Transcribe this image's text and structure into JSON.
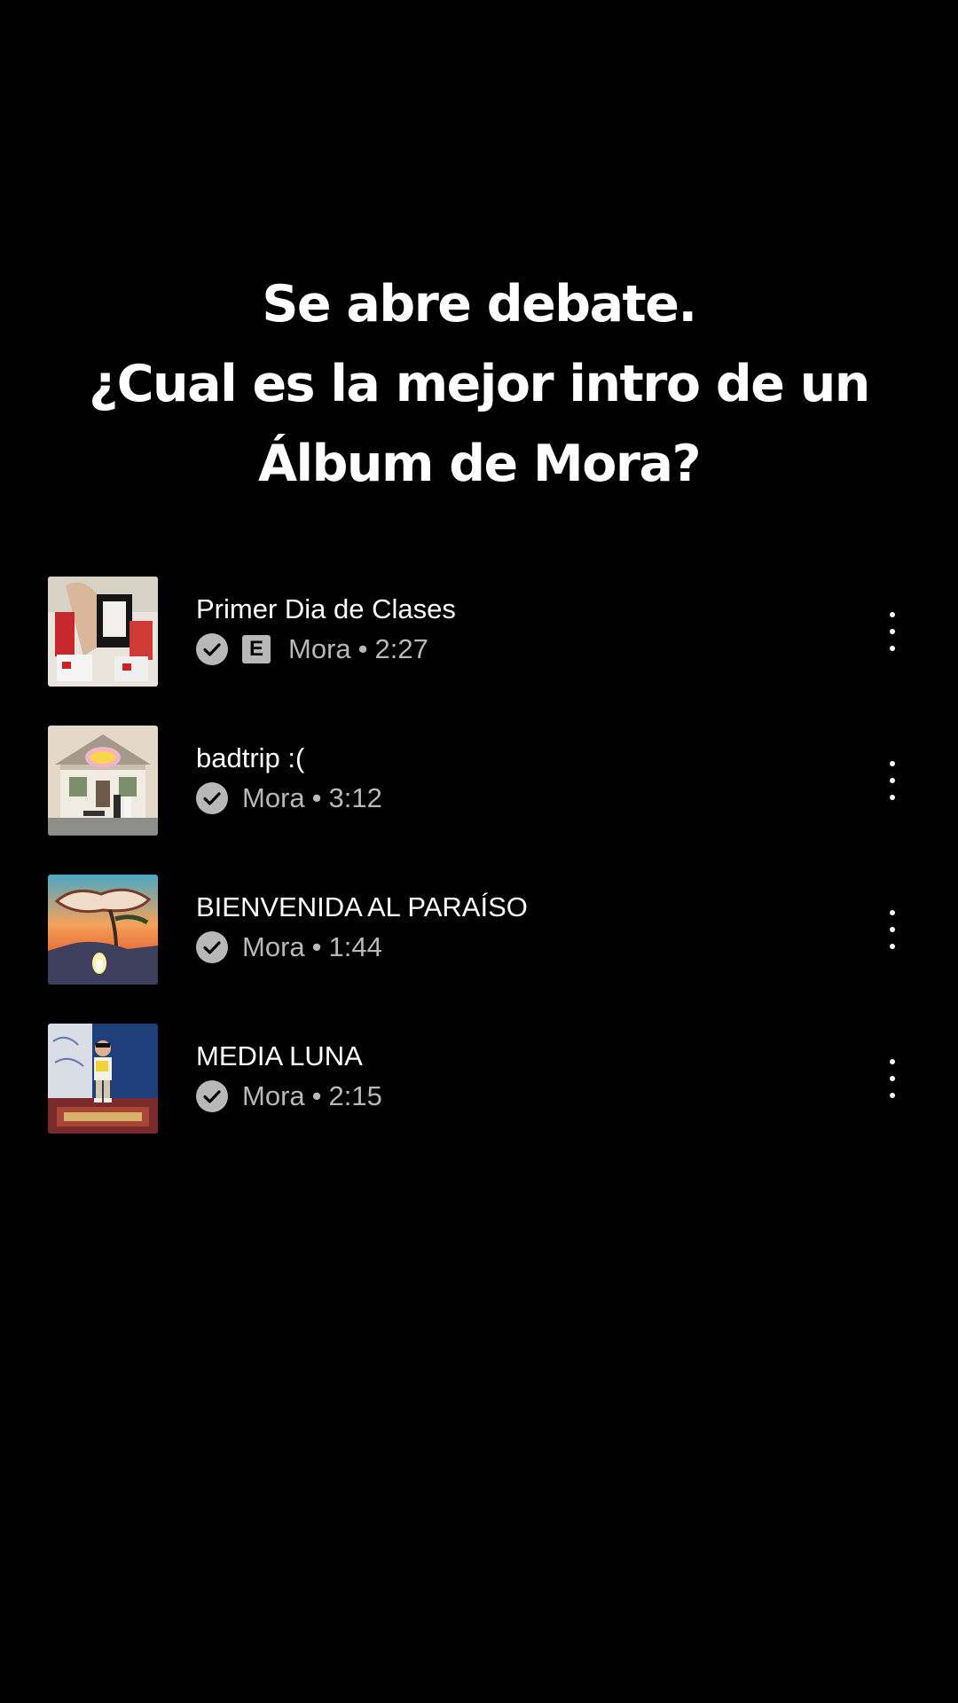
{
  "headline": {
    "line1": "Se abre debate.",
    "line2": "¿Cual es la mejor intro de un",
    "line3": "Álbum de Mora?"
  },
  "tracks": [
    {
      "title": "Primer Dia de Clases",
      "artist": "Mora",
      "duration": "2:27",
      "explicit": true,
      "explicit_label": "E",
      "artwork_icon": "album-art-primer-dia-de-clases"
    },
    {
      "title": "badtrip :(",
      "artist": "Mora",
      "duration": "3:12",
      "explicit": false,
      "artwork_icon": "album-art-house"
    },
    {
      "title": "BIENVENIDA AL PARAÍSO",
      "artist": "Mora",
      "duration": "1:44",
      "explicit": false,
      "artwork_icon": "album-art-paraiso"
    },
    {
      "title": "MEDIA LUNA",
      "artist": "Mora",
      "duration": "2:15",
      "explicit": false,
      "artwork_icon": "album-art-child"
    }
  ],
  "separator": "•",
  "colors": {
    "background": "#000000",
    "title_text": "#ffffff",
    "meta_text": "#b8b8b8"
  }
}
